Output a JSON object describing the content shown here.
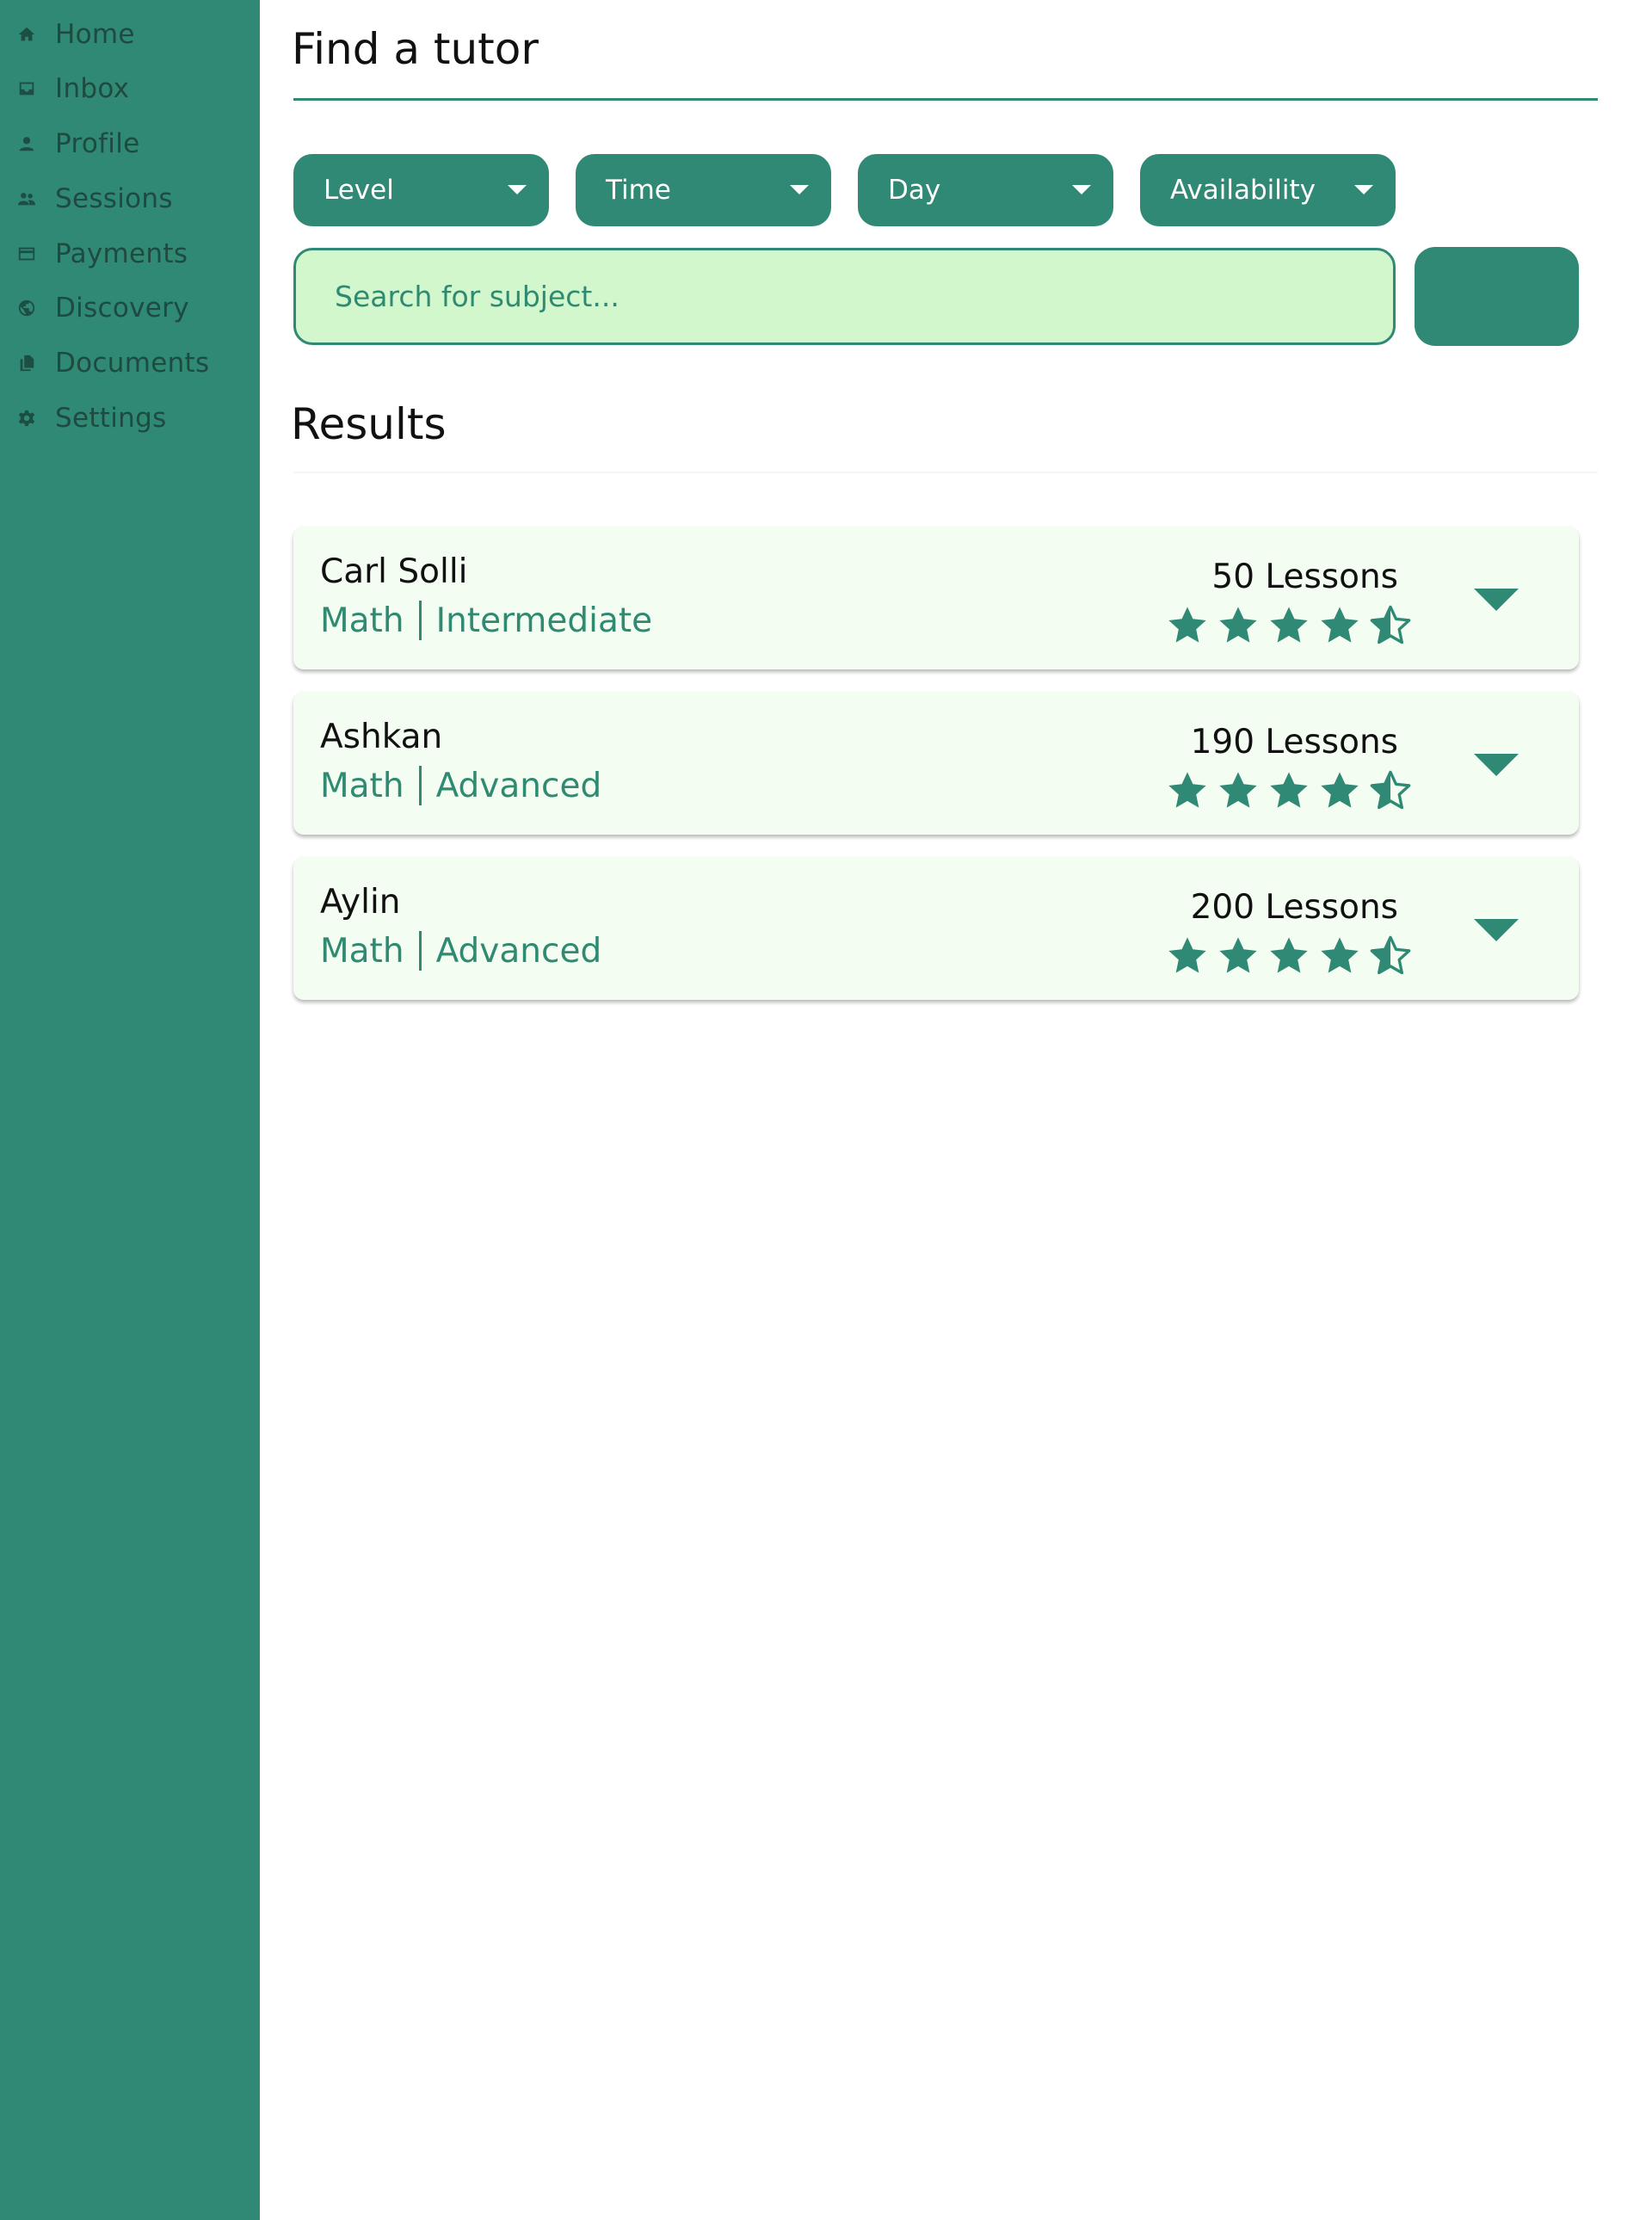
{
  "sidebar": {
    "items": [
      {
        "label": "Home",
        "icon": "home-icon"
      },
      {
        "label": "Inbox",
        "icon": "inbox-icon"
      },
      {
        "label": "Profile",
        "icon": "person-icon"
      },
      {
        "label": "Sessions",
        "icon": "people-icon"
      },
      {
        "label": "Payments",
        "icon": "credit-card-icon"
      },
      {
        "label": "Discovery",
        "icon": "globe-icon"
      },
      {
        "label": "Documents",
        "icon": "documents-icon"
      },
      {
        "label": "Settings",
        "icon": "gear-icon"
      }
    ]
  },
  "header": {
    "title": "Find a tutor"
  },
  "filters": [
    {
      "label": "Level"
    },
    {
      "label": "Time"
    },
    {
      "label": "Day"
    },
    {
      "label": "Availability"
    }
  ],
  "search": {
    "placeholder": "Search for subject...",
    "value": ""
  },
  "results": {
    "heading": "Results",
    "items": [
      {
        "name": "Carl Solli",
        "subject": "Math",
        "level": "Intermediate",
        "lessons": "50 Lessons",
        "rating": 4.5
      },
      {
        "name": "Ashkan",
        "subject": "Math",
        "level": "Advanced",
        "lessons": "190 Lessons",
        "rating": 4.5
      },
      {
        "name": "Aylin",
        "subject": "Math",
        "level": "Advanced",
        "lessons": "200 Lessons",
        "rating": 4.5
      }
    ]
  },
  "colors": {
    "accent": "#308975",
    "search_bg": "#d2f7cd",
    "card_bg": "#f4fdf1",
    "sidebar_text": "#1e4a40"
  }
}
